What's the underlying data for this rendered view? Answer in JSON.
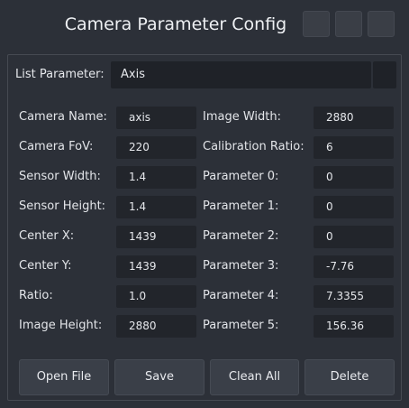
{
  "window": {
    "title": "Camera Parameter Config"
  },
  "list_parameter": {
    "label": "List Parameter:",
    "value": "Axis"
  },
  "left_fields": [
    {
      "label": "Camera Name:",
      "value": "axis"
    },
    {
      "label": "Camera FoV:",
      "value": "220"
    },
    {
      "label": "Sensor Width:",
      "value": "1.4"
    },
    {
      "label": "Sensor Height:",
      "value": "1.4"
    },
    {
      "label": "Center X:",
      "value": "1439"
    },
    {
      "label": "Center Y:",
      "value": "1439"
    },
    {
      "label": "Ratio:",
      "value": "1.0"
    },
    {
      "label": "Image Height:",
      "value": "2880"
    }
  ],
  "right_fields": [
    {
      "label": "Image Width:",
      "value": "2880"
    },
    {
      "label": "Calibration Ratio:",
      "value": "6"
    },
    {
      "label": "Parameter 0:",
      "value": "0"
    },
    {
      "label": "Parameter 1:",
      "value": "0"
    },
    {
      "label": "Parameter 2:",
      "value": "0"
    },
    {
      "label": "Parameter 3:",
      "value": "-7.76"
    },
    {
      "label": "Parameter 4:",
      "value": "7.3355"
    },
    {
      "label": "Parameter 5:",
      "value": "156.36"
    }
  ],
  "buttons": {
    "open_file": "Open File",
    "save": "Save",
    "clean_all": "Clean All",
    "delete": "Delete"
  }
}
